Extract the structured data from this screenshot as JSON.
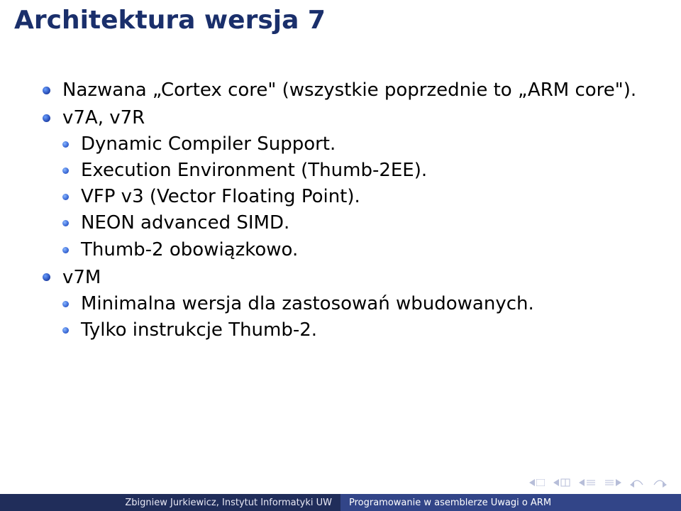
{
  "slide": {
    "title": "Architektura wersja 7",
    "bullets_level1": {
      "b0": "Nazwana „Cortex core\" (wszystkie poprzednie to „ARM core\").",
      "b1": "v7A, v7R",
      "b2": "v7M"
    },
    "bullets_b1_children": {
      "c0": "Dynamic Compiler Support.",
      "c1": "Execution Environment (Thumb-2EE).",
      "c2": "VFP v3 (Vector Floating Point).",
      "c3": "NEON advanced SIMD.",
      "c4": "Thumb-2 obowiązkowo."
    },
    "bullets_b2_children": {
      "c0": "Minimalna wersja dla zastosowań wbudowanych.",
      "c1": "Tylko instrukcje Thumb-2."
    }
  },
  "footer": {
    "author": "Zbigniew Jurkiewicz, Instytut Informatyki UW",
    "title_short": "Programowanie w asemblerze Uwagi o ARM"
  }
}
